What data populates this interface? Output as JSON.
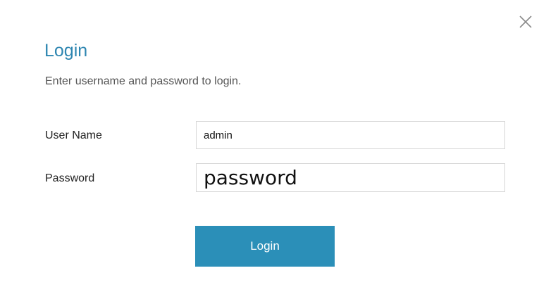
{
  "dialog": {
    "title": "Login",
    "subtitle": "Enter username and password to login.",
    "close_icon": "close-icon"
  },
  "form": {
    "username_label": "User Name",
    "username_value": "admin",
    "password_label": "Password",
    "password_value": "password",
    "login_label": "Login"
  },
  "colors": {
    "accent": "#2e86b1",
    "button": "#2b8fb8"
  }
}
